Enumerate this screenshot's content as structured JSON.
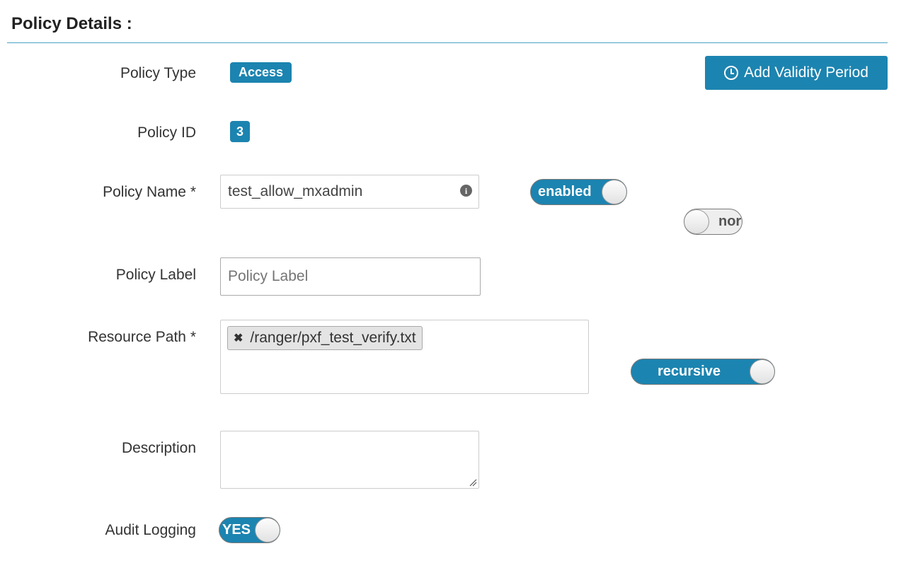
{
  "section": {
    "title": "Policy Details :"
  },
  "labels": {
    "policy_type": "Policy Type",
    "policy_id": "Policy ID",
    "policy_name": "Policy Name *",
    "policy_label": "Policy Label",
    "resource_path": "Resource Path *",
    "description": "Description",
    "audit_logging": "Audit Logging"
  },
  "policy_type": {
    "value": "Access"
  },
  "policy_id": {
    "value": "3"
  },
  "add_validity": {
    "label": "Add Validity Period",
    "icon": "clock-icon"
  },
  "policy_name": {
    "value": "test_allow_mxadmin",
    "info_icon": "info-icon"
  },
  "policy_label": {
    "placeholder": "Policy Label",
    "value": ""
  },
  "toggles": {
    "enabled": {
      "label": "enabled",
      "state": true
    },
    "override": {
      "label": "nor",
      "state": false
    },
    "recursive": {
      "label": "recursive",
      "state": true
    },
    "audit": {
      "label": "YES",
      "state": true
    }
  },
  "resource_path": {
    "tags": [
      "/ranger/pxf_test_verify.txt"
    ],
    "remove_icon": "close-icon"
  },
  "description": {
    "value": ""
  },
  "colors": {
    "accent": "#1c84b0",
    "rule": "#4aa3c4"
  }
}
